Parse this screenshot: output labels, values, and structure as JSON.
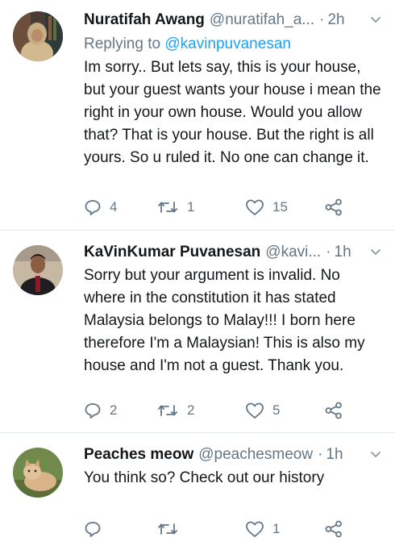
{
  "tweets": [
    {
      "name": "Nuratifah Awang",
      "handle": "@nuratifah_a...",
      "dot": "·",
      "time": "2h",
      "reply_prefix": "Replying to ",
      "reply_to": "@kavinpuvanesan",
      "text": "Im sorry.. But lets say, this is your house, but your guest wants your house i mean the right in your own house. Would you allow that? That is your house. But the right is all yours. So u ruled it. No one can change it.",
      "replies": "4",
      "retweets": "1",
      "likes": "15"
    },
    {
      "name": "KaVinKumar Puvanesan",
      "handle": "@kavi...",
      "dot": "·",
      "time": "1h",
      "text": "Sorry but your argument is invalid. No where in the constitution it has stated Malaysia belongs to Malay!!! I born here therefore I'm a Malaysian! This is also my house and I'm not a guest. Thank you.",
      "replies": "2",
      "retweets": "2",
      "likes": "5"
    },
    {
      "name": "Peaches meow",
      "handle": "@peachesmeow",
      "dot": "·",
      "time": "1h",
      "text": "You think so? Check out our history",
      "replies": "",
      "retweets": "",
      "likes": "1"
    }
  ],
  "colors": {
    "text": "#14171a",
    "secondary": "#657786",
    "link": "#1da1f2",
    "divider": "#e1e8ed"
  },
  "icons": [
    "reply-icon",
    "retweet-icon",
    "like-icon",
    "share-icon",
    "chevron-down-icon"
  ]
}
